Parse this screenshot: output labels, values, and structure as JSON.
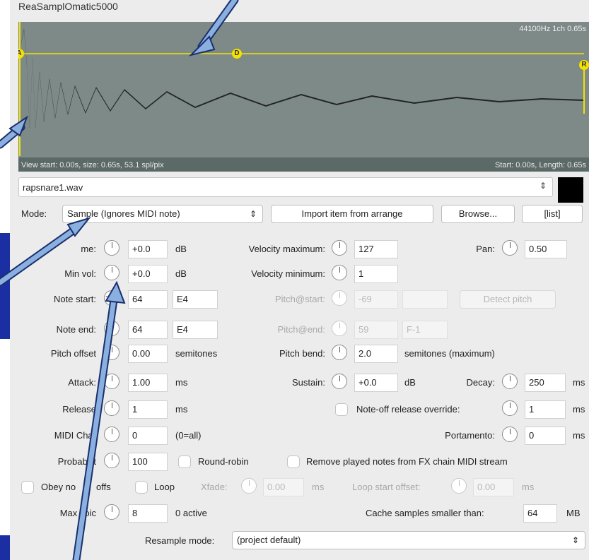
{
  "window": {
    "title": "ReaSamplOmatic5000"
  },
  "waveform": {
    "info": "44100Hz 1ch 0.65s",
    "view": "View start: 0.00s, size: 0.65s, 53.1 spl/pix",
    "start": "Start: 0.00s, Length: 0.65s",
    "markers": {
      "attack": "A",
      "decay": "D",
      "release": "R"
    }
  },
  "file": {
    "name": "rapsnare1.wav"
  },
  "mode": {
    "label": "Mode:",
    "value": "Sample (Ignores MIDI note)",
    "import": "Import item from arrange",
    "browse": "Browse...",
    "list": "[list]"
  },
  "params": {
    "volume": {
      "label": "me:",
      "value": "+0.0",
      "unit": "dB"
    },
    "minvol": {
      "label": "Min vol:",
      "value": "+0.0",
      "unit": "dB"
    },
    "notestart": {
      "label": "Note start:",
      "value": "64",
      "note": "E4"
    },
    "noteend": {
      "label": "Note end:",
      "value": "64",
      "note": "E4"
    },
    "pitchoffset": {
      "label": "Pitch offset",
      "value": "0.00",
      "unit": "semitones"
    },
    "attack": {
      "label": "Attack:",
      "value": "1.00",
      "unit": "ms"
    },
    "release": {
      "label": "Release",
      "value": "1",
      "unit": "ms"
    },
    "midichan": {
      "label": "MIDI Char",
      "value": "0",
      "unit": "(0=all)"
    },
    "probability": {
      "label": "Probabilit",
      "value": "100"
    },
    "maxvoices": {
      "label": "Max voic",
      "value": "8",
      "unit": "0 active"
    },
    "velmax": {
      "label": "Velocity maximum:",
      "value": "127"
    },
    "velmin": {
      "label": "Velocity minimum:",
      "value": "1"
    },
    "pitchstart": {
      "label": "Pitch@start:",
      "value": "-69",
      "value2": ""
    },
    "pitchend": {
      "label": "Pitch@end:",
      "value": "59",
      "value2": "F-1"
    },
    "pitchbend": {
      "label": "Pitch bend:",
      "value": "2.0",
      "unit": "semitones (maximum)"
    },
    "sustain": {
      "label": "Sustain:",
      "value": "+0.0",
      "unit": "dB"
    },
    "pan": {
      "label": "Pan:",
      "value": "0.50"
    },
    "decay": {
      "label": "Decay:",
      "value": "250",
      "unit": "ms"
    },
    "noteoff": {
      "label": "Note-off release override:",
      "value": "1",
      "unit": "ms"
    },
    "portamento": {
      "label": "Portamento:",
      "value": "0",
      "unit": "ms"
    },
    "detect": "Detect pitch",
    "roundrobin": "Round-robin",
    "removenotes": "Remove played notes from FX chain MIDI stream",
    "obey": "Obey no",
    "offs": "offs",
    "loop": "Loop",
    "xfade": {
      "label": "Xfade:",
      "value": "0.00",
      "unit": "ms"
    },
    "loopstart": {
      "label": "Loop start offset:",
      "value": "0.00",
      "unit": "ms"
    },
    "cache": {
      "label": "Cache samples smaller than:",
      "value": "64",
      "unit": "MB"
    },
    "resample": {
      "label": "Resample mode:",
      "value": "(project default)"
    }
  }
}
